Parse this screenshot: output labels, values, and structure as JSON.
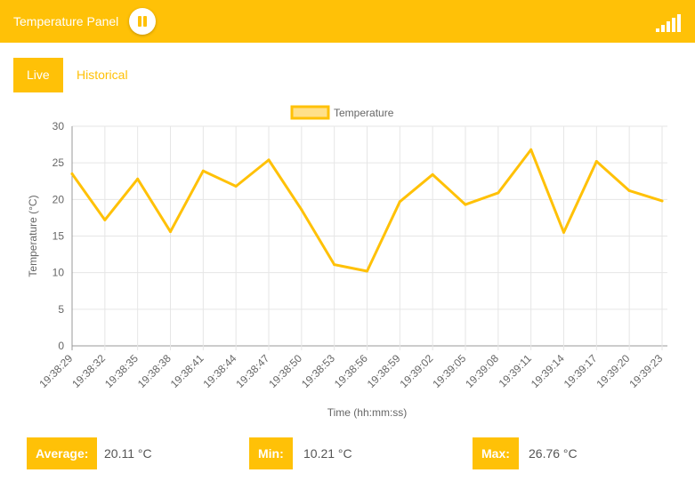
{
  "header": {
    "title": "Temperature Panel",
    "pause_icon": "pause-icon",
    "signal_icon": "signal-bars-icon",
    "accent": "#ffc107"
  },
  "tabs": [
    {
      "label": "Live",
      "active": true
    },
    {
      "label": "Historical",
      "active": false
    }
  ],
  "stats": {
    "average": {
      "label": "Average:",
      "value": "20.11 °C"
    },
    "min": {
      "label": "Min:",
      "value": "10.21 °C"
    },
    "max": {
      "label": "Max:",
      "value": "26.76 °C"
    }
  },
  "chart_data": {
    "type": "line",
    "title": "",
    "xlabel": "Time (hh:mm:ss)",
    "ylabel": "Temperature (°C)",
    "ylim": [
      0,
      30
    ],
    "yticks": [
      0,
      5,
      10,
      15,
      20,
      25,
      30
    ],
    "grid": true,
    "legend_position": "top-center",
    "categories": [
      "19:38:29",
      "19:38:32",
      "19:38:35",
      "19:38:38",
      "19:38:41",
      "19:38:44",
      "19:38:47",
      "19:38:50",
      "19:38:53",
      "19:38:56",
      "19:38:59",
      "19:39:02",
      "19:39:05",
      "19:39:08",
      "19:39:11",
      "19:39:14",
      "19:39:17",
      "19:39:20",
      "19:39:23"
    ],
    "series": [
      {
        "name": "Temperature",
        "color": "#ffc107",
        "fill": "#ffe08a",
        "values": [
          23.5,
          17.2,
          22.8,
          15.6,
          23.9,
          21.8,
          25.4,
          18.6,
          11.1,
          10.2,
          19.7,
          23.4,
          19.3,
          20.9,
          26.8,
          15.5,
          25.2,
          21.2,
          19.8
        ]
      }
    ]
  }
}
